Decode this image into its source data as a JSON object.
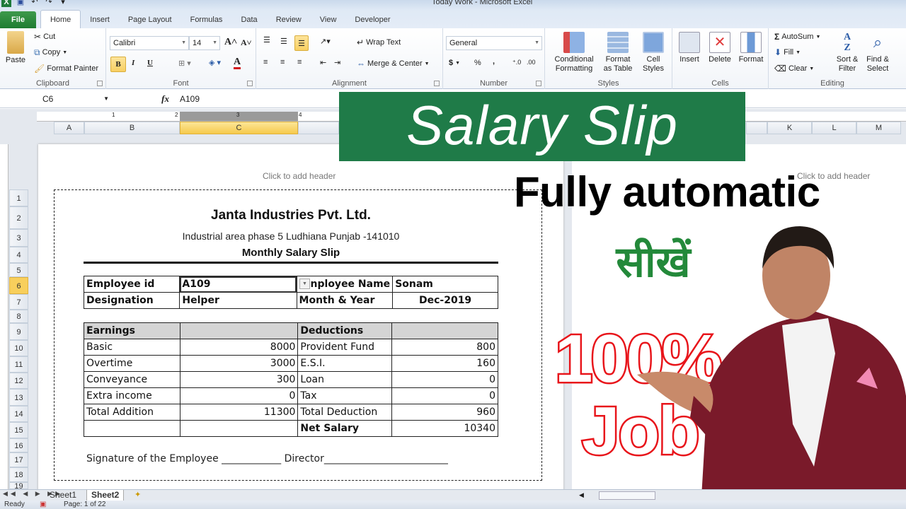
{
  "window": {
    "title": "Today Work  -  Microsoft Excel"
  },
  "quick_access": [
    "excel-logo",
    "save",
    "undo",
    "redo",
    "customize"
  ],
  "ribbon_tabs": [
    {
      "label": "File",
      "active": false
    },
    {
      "label": "Home",
      "active": true
    },
    {
      "label": "Insert",
      "active": false
    },
    {
      "label": "Page Layout",
      "active": false
    },
    {
      "label": "Formulas",
      "active": false
    },
    {
      "label": "Data",
      "active": false
    },
    {
      "label": "Review",
      "active": false
    },
    {
      "label": "View",
      "active": false
    },
    {
      "label": "Developer",
      "active": false
    }
  ],
  "ribbon": {
    "clipboard": {
      "label": "Clipboard",
      "paste": "Paste",
      "cut": "Cut",
      "copy": "Copy",
      "format_painter": "Format Painter"
    },
    "font": {
      "label": "Font",
      "font_name": "Calibri",
      "font_size": "14",
      "bold": "B",
      "italic": "I",
      "underline": "U"
    },
    "alignment": {
      "label": "Alignment",
      "wrap_text": "Wrap Text",
      "merge_center": "Merge & Center"
    },
    "number": {
      "label": "Number",
      "format": "General",
      "currency": "$",
      "percent": "%",
      "comma": ","
    },
    "styles": {
      "label": "Styles",
      "conditional_1": "Conditional",
      "conditional_2": "Formatting",
      "format_table_1": "Format",
      "format_table_2": "as Table",
      "cell_styles_1": "Cell",
      "cell_styles_2": "Styles"
    },
    "cells": {
      "label": "Cells",
      "insert": "Insert",
      "delete": "Delete",
      "format": "Format"
    },
    "editing": {
      "label": "Editing",
      "autosum": "AutoSum",
      "fill": "Fill",
      "clear": "Clear",
      "sort_1": "Sort &",
      "sort_2": "Filter",
      "find_1": "Find &",
      "find_2": "Select"
    }
  },
  "formula_bar": {
    "name_box": "C6",
    "fx": "fx",
    "value": "A109"
  },
  "columns": {
    "left": [
      "A",
      "B",
      "C"
    ],
    "right": [
      "K",
      "L",
      "M"
    ],
    "selected": "C"
  },
  "rows": {
    "labels": [
      "1",
      "2",
      "3",
      "4",
      "5",
      "6",
      "7",
      "8",
      "9",
      "10",
      "11",
      "12",
      "13",
      "14",
      "15",
      "16",
      "17",
      "18",
      "19"
    ],
    "selected": "6"
  },
  "ruler": [
    "1",
    "2",
    "3",
    "4"
  ],
  "page_header_hint": "Click to add header",
  "slip": {
    "company": "Janta Industries Pvt. Ltd.",
    "address": "Industrial area phase 5 Ludhiana Punjab -141010",
    "title": "Monthly Salary Slip",
    "info": [
      [
        "Employee id",
        "A109",
        "Employee Name",
        "Sonam"
      ],
      [
        "Designation",
        "Helper",
        "Month & Year",
        "Dec-2019"
      ]
    ],
    "info_visible_label": "nployee Name",
    "earnings_header": "Earnings",
    "deductions_header": "Deductions",
    "rows": [
      {
        "earning": "Basic",
        "earning_amt": "8000",
        "deduction": "Provident Fund",
        "deduction_amt": "800"
      },
      {
        "earning": "Overtime",
        "earning_amt": "3000",
        "deduction": "E.S.I.",
        "deduction_amt": "160"
      },
      {
        "earning": "Conveyance",
        "earning_amt": "300",
        "deduction": "Loan",
        "deduction_amt": "0"
      },
      {
        "earning": "Extra income",
        "earning_amt": "0",
        "deduction": "Tax",
        "deduction_amt": "0"
      },
      {
        "earning": "Total Addition",
        "earning_amt": "11300",
        "deduction": "Total Deduction",
        "deduction_amt": "960"
      },
      {
        "earning": "",
        "earning_amt": "",
        "deduction": "Net Salary",
        "deduction_amt": "10340"
      }
    ],
    "signature": "Signature of the Employee ____________ Director_________________________"
  },
  "sheets": [
    {
      "label": "Sheet1",
      "active": false
    },
    {
      "label": "Sheet2",
      "active": true
    }
  ],
  "status": {
    "ready": "Ready",
    "page": "Page: 1 of 22"
  },
  "overlay": {
    "banner": "Salary Slip",
    "subtitle": "Fully automatic",
    "hindi": "सीखें",
    "promo_1": "100%",
    "promo_2": "Job",
    "colors": {
      "banner_bg": "#1f7b48",
      "hindi": "#23893a",
      "promo_stroke": "#e8151b",
      "blazer": "#7a1a2a"
    }
  }
}
